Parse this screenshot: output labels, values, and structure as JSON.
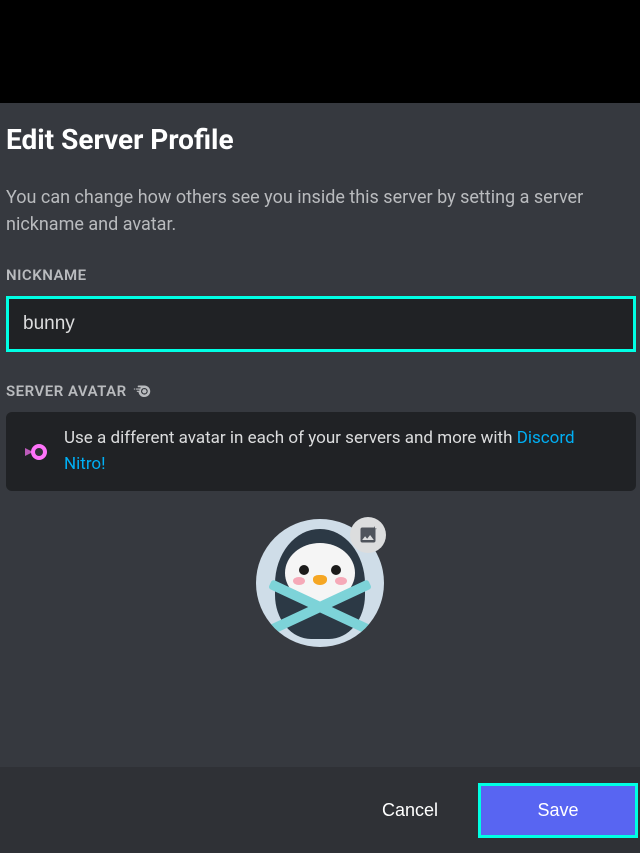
{
  "modal": {
    "title": "Edit Server Profile",
    "description": "You can change how others see you inside this server by setting a server nickname and avatar.",
    "nickname_label": "NICKNAME",
    "nickname_value": "bunny",
    "avatar_label": "SERVER AVATAR",
    "nitro_text": "Use a different avatar in each of your servers and more with ",
    "nitro_link": "Discord Nitro!",
    "cancel_label": "Cancel",
    "save_label": "Save"
  }
}
